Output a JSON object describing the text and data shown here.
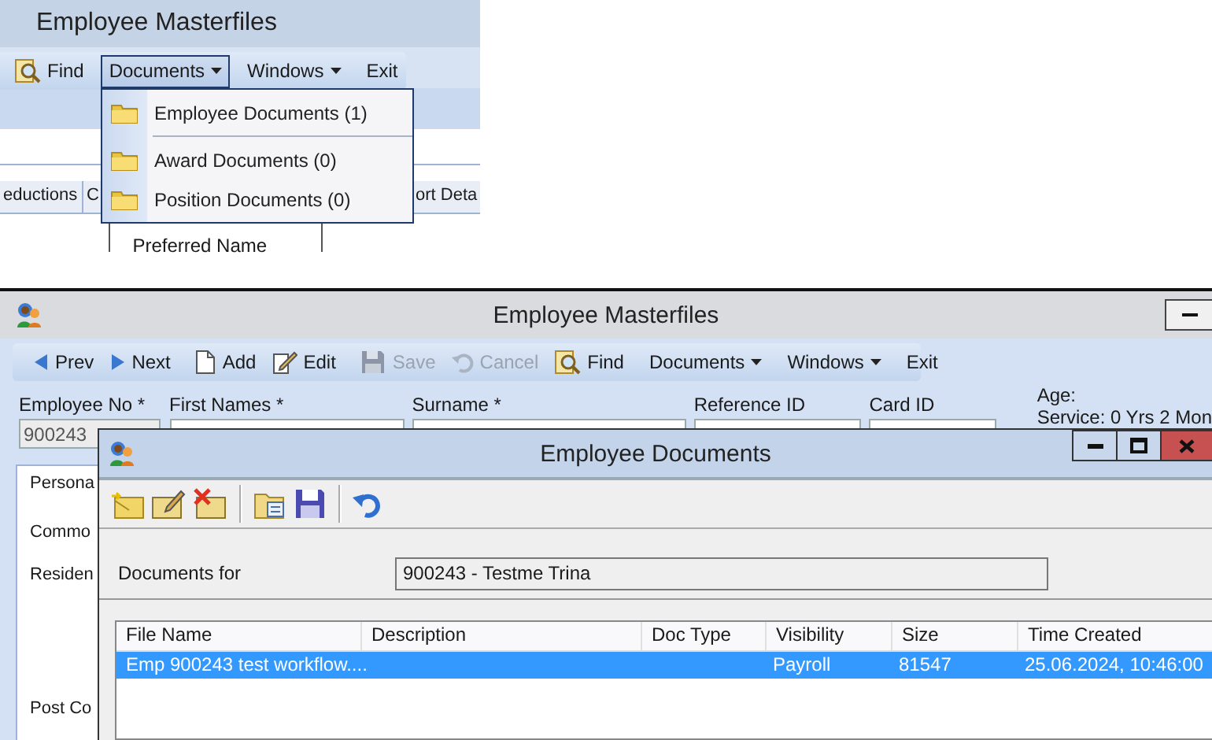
{
  "inset": {
    "title": "Employee Masterfiles",
    "toolbar": [
      [
        {
          "kind": "find",
          "label": "Find",
          "selected": false
        }
      ],
      [
        {
          "kind": "dropdown",
          "label": "Documents",
          "selected": true
        }
      ],
      [
        {
          "kind": "dropdown",
          "label": "Windows",
          "selected": false
        }
      ],
      [
        {
          "kind": "plain",
          "label": "Exit",
          "selected": false
        }
      ]
    ],
    "menu": [
      [
        {
          "label": "Employee Documents (1)"
        }
      ],
      [
        {
          "label": "Award Documents (0)"
        },
        {
          "label": "Position Documents (0)"
        }
      ]
    ],
    "tabs": [
      "eductions",
      "C",
      "ort Deta"
    ],
    "field_label": "Preferred Name"
  },
  "main": {
    "title": "Employee Masterfiles",
    "toolbar": [
      [
        {
          "kind": "prev",
          "label": "Prev",
          "disabled": false
        },
        {
          "kind": "next",
          "label": "Next",
          "disabled": false
        }
      ],
      [
        {
          "kind": "add",
          "label": "Add",
          "disabled": false
        },
        {
          "kind": "edit",
          "label": "Edit",
          "disabled": false
        }
      ],
      [
        {
          "kind": "save",
          "label": "Save",
          "disabled": true
        },
        {
          "kind": "cancel",
          "label": "Cancel",
          "disabled": true
        },
        {
          "kind": "find",
          "label": "Find",
          "disabled": false
        }
      ],
      [
        {
          "kind": "dropdown",
          "label": "Documents",
          "disabled": false
        }
      ],
      [
        {
          "kind": "dropdown",
          "label": "Windows",
          "disabled": false
        }
      ],
      [
        {
          "kind": "plain",
          "label": "Exit",
          "disabled": false
        }
      ]
    ],
    "fields": [
      {
        "label": "Employee No *",
        "value": "900243",
        "readonly": true
      },
      {
        "label": "First Names *",
        "readonly": false
      },
      {
        "label": "Surname *",
        "readonly": false
      },
      {
        "label": "Reference ID",
        "readonly": false
      },
      {
        "label": "Card ID",
        "readonly": false
      }
    ],
    "age_label": "Age:",
    "service": "Service: 0 Yrs 2 Mon",
    "side_labels": [
      "Persona",
      "Commo",
      "Residen",
      "Post Co"
    ]
  },
  "dialog": {
    "title": "Employee Documents",
    "toolbar": [
      [
        {
          "kind": "new"
        },
        {
          "kind": "edit-doc"
        },
        {
          "kind": "delete"
        }
      ],
      [
        {
          "kind": "open"
        },
        {
          "kind": "save"
        }
      ],
      [
        {
          "kind": "undo"
        }
      ]
    ],
    "documents_for_label": "Documents for",
    "documents_for_value": "900243 - Testme Trina",
    "table": {
      "columns": [
        "File Name",
        "Description",
        "Doc Type",
        "Visibility",
        "Size",
        "Time Created"
      ],
      "rows": [
        {
          "cells": [
            "Emp 900243 test workflow....",
            "",
            "",
            "Payroll",
            "81547",
            "25.06.2024, 10:46:00"
          ],
          "selected": true
        }
      ]
    }
  }
}
